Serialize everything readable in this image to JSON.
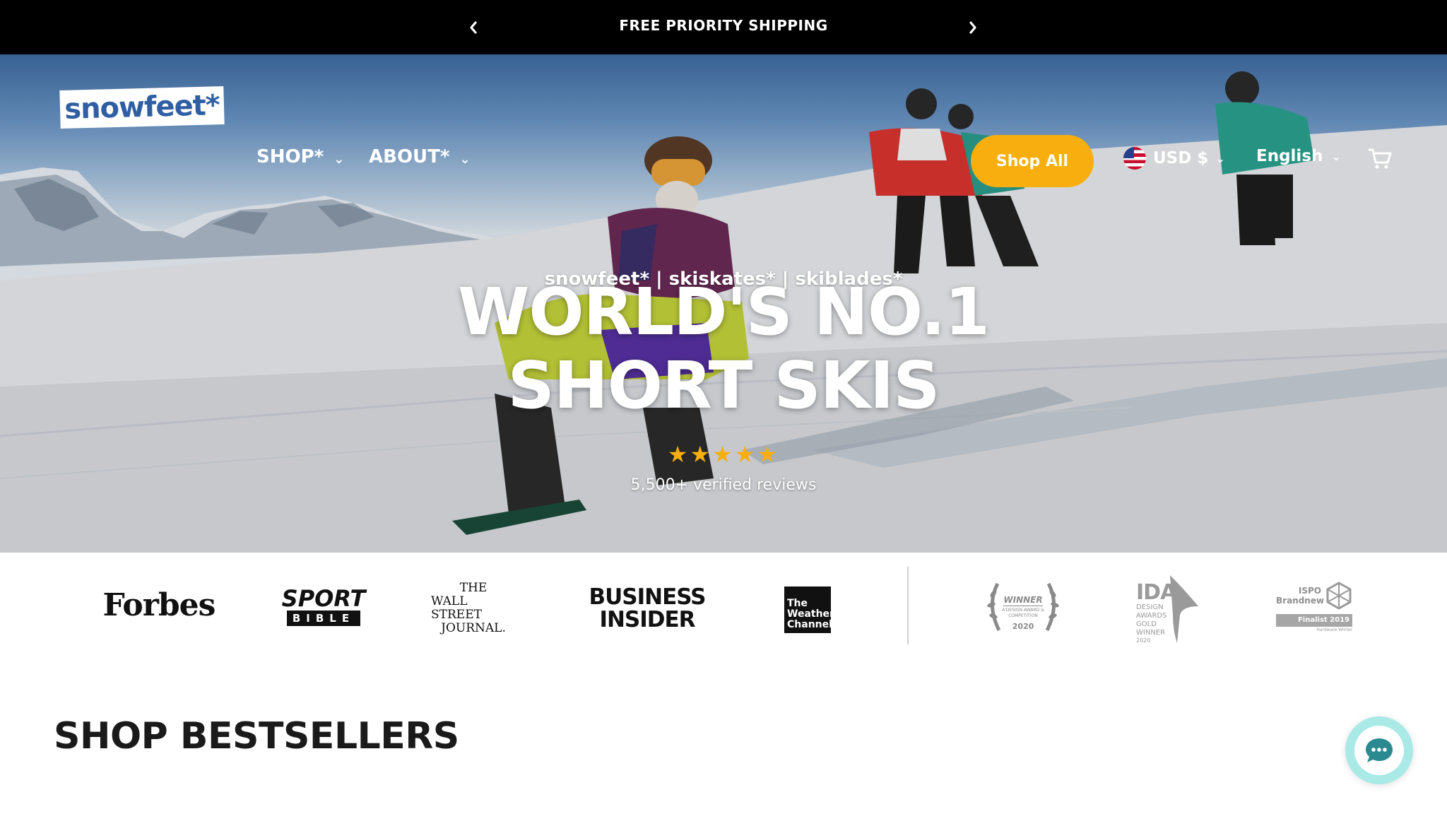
{
  "announcement": {
    "text": "FREE PRIORITY SHIPPING",
    "prev_icon": "chevron-left-icon",
    "next_icon": "chevron-right-icon"
  },
  "header": {
    "logo_text": "snowfeet*",
    "nav": [
      {
        "label": "SHOP*"
      },
      {
        "label": "ABOUT*"
      }
    ],
    "cta_label": "Shop All",
    "currency": "USD $",
    "language": "English",
    "cart_icon": "cart-icon"
  },
  "hero": {
    "tagline": "snowfeet* | skiskates* | skiblades*",
    "headline_line1": "WORLD'S NO.1",
    "headline_line2": "SHORT SKIS",
    "stars": "★★★★★",
    "rating": 5,
    "reviews": "5,500+ verified reviews"
  },
  "press": {
    "media": [
      {
        "name": "Forbes"
      },
      {
        "name": "SPORT",
        "sub": "BIBLE"
      },
      {
        "name": "THE",
        "sub": "WALL STREET",
        "sub2": "JOURNAL."
      },
      {
        "name": "BUSINESS",
        "sub": "INSIDER"
      },
      {
        "name": "The",
        "sub": "Weather",
        "sub2": "Channel"
      }
    ],
    "awards": [
      {
        "name": "WINNER",
        "sub": "A'DESIGN AWARD & COMPETITION",
        "year": "2020"
      },
      {
        "name": "IDA",
        "sub": "DESIGN AWARDS GOLD WINNER",
        "year": "2020"
      },
      {
        "name": "ISPO Brandnew",
        "sub": "Finalist 2019",
        "note": "Hardware Winter"
      }
    ]
  },
  "bestsellers": {
    "title": "SHOP BESTSELLERS"
  },
  "colors": {
    "accent": "#f7ae0e",
    "logo_blue": "#2f5fa2",
    "chat": "#a9e9e6"
  }
}
